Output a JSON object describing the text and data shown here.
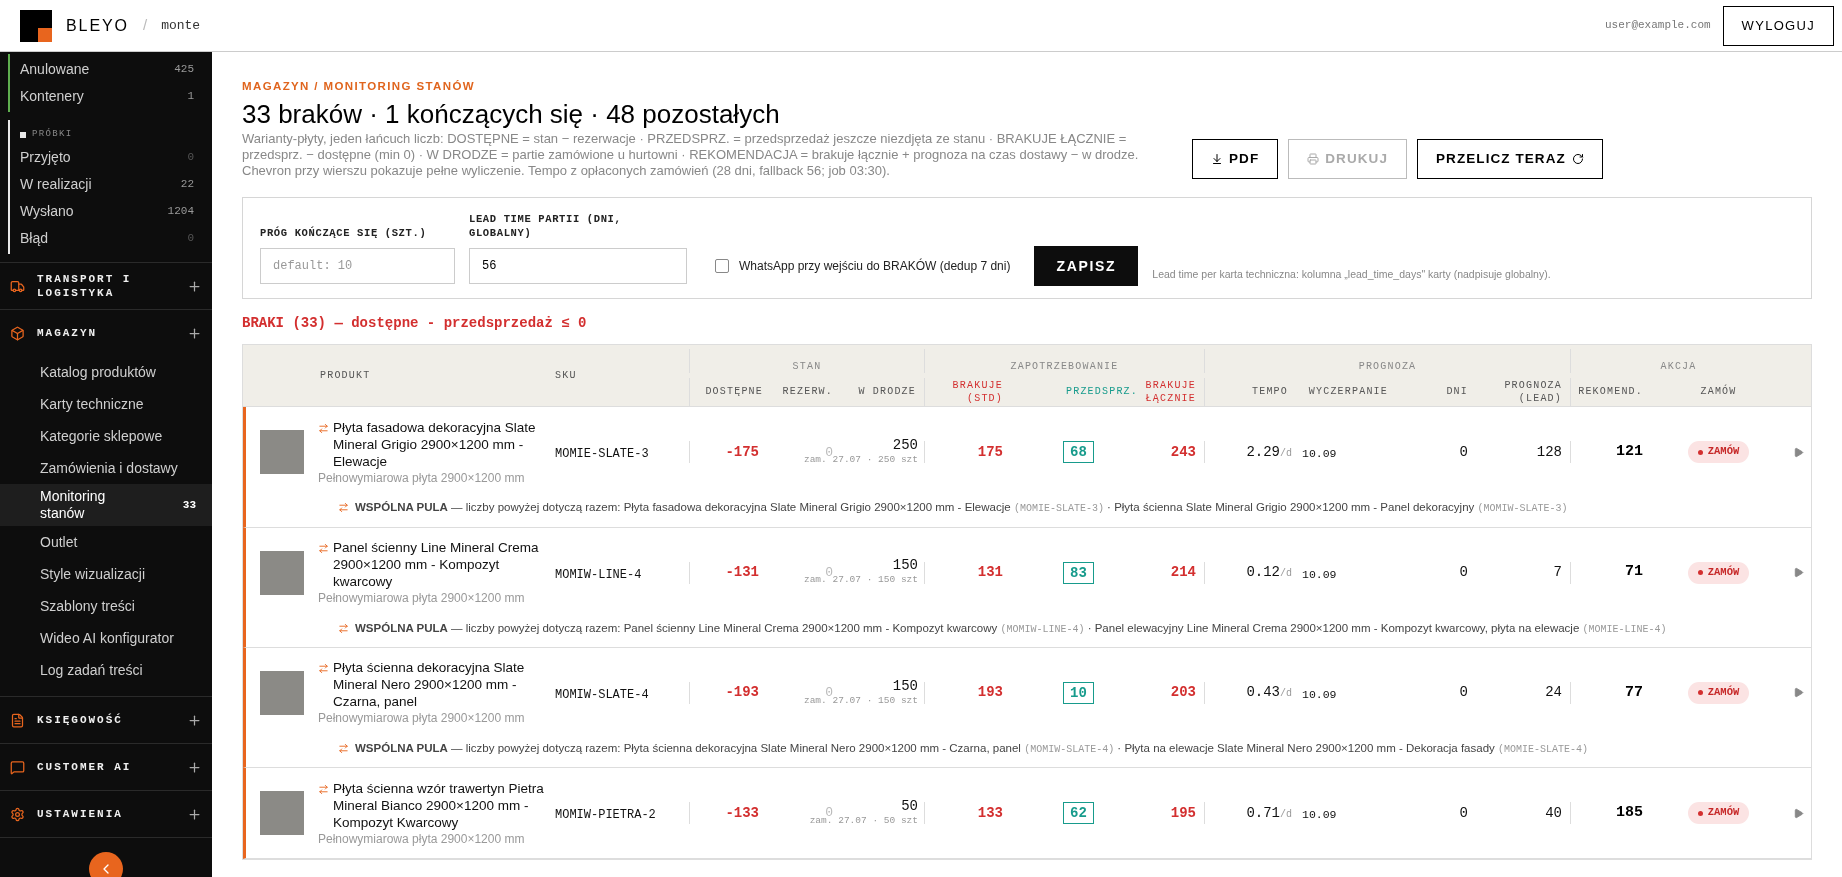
{
  "header": {
    "logo": "BLEYO",
    "separator": "/",
    "tenant": "monte",
    "user": "user@example.com",
    "logout": "WYLOGUJ"
  },
  "sidebar": {
    "status_groups": [
      {
        "color": "#5fae4f",
        "items": [
          {
            "label": "Anulowane",
            "count": "425",
            "muted": false
          },
          {
            "label": "Kontenery",
            "count": "1",
            "muted": false
          }
        ]
      },
      {
        "color": "#e8e8e8",
        "title": "PRÓBKI",
        "items": [
          {
            "label": "Przyjęto",
            "count": "0",
            "muted": true
          },
          {
            "label": "W realizacji",
            "count": "22",
            "muted": false
          },
          {
            "label": "Wysłano",
            "count": "1204",
            "muted": false
          },
          {
            "label": "Błąd",
            "count": "0",
            "muted": true
          }
        ]
      }
    ],
    "sections": [
      {
        "label": "TRANSPORT I LOGISTYKA",
        "kind": "truck"
      },
      {
        "label": "MAGAZYN",
        "kind": "box",
        "items": [
          {
            "label": "Katalog produktów",
            "selected": false
          },
          {
            "label": "Karty techniczne",
            "selected": false
          },
          {
            "label": "Kategorie sklepowe",
            "selected": false
          },
          {
            "label": "Zamówienia i dostawy",
            "selected": false
          },
          {
            "label": "Monitoring stanów",
            "selected": true,
            "count": "33"
          },
          {
            "label": "Outlet",
            "selected": false
          },
          {
            "label": "Style wizualizacji",
            "selected": false
          },
          {
            "label": "Szablony treści",
            "selected": false
          },
          {
            "label": "Wideo AI konfigurator",
            "selected": false
          },
          {
            "label": "Log zadań treści",
            "selected": false
          }
        ]
      },
      {
        "label": "KSIĘGOWOŚĆ",
        "kind": "document"
      },
      {
        "label": "CUSTOMER AI",
        "kind": "chat"
      },
      {
        "label": "USTAWIENIA",
        "kind": "gear"
      }
    ]
  },
  "page": {
    "breadcrumb": "MAGAZYN / MONITORING STANÓW",
    "title": "33 braków · 1 kończących się · 48 pozostałych",
    "description": "Warianty-płyty, jeden łańcuch liczb: DOSTĘPNE = stan − rezerwacje · PRZEDSPRZ. = przedsprzedaż jeszcze niezdjęta ze stanu · BRAKUJE ŁĄCZNIE = przedsprz. − dostępne (min 0) · W DRODZE = partie zamówione u hurtowni · REKOMENDACJA = brakuje łącznie + prognoza na czas dostawy − w drodze. Chevron przy wierszu pokazuje pełne wyliczenie. Tempo z opłaconych zamówień (28 dni, fallback 56; job 03:30).",
    "actions": [
      {
        "label": "PDF",
        "kind": "download",
        "disabled": false
      },
      {
        "label": "DRUKUJ",
        "kind": "print",
        "disabled": true
      },
      {
        "label": "PRZELICZ TERAZ",
        "kind": "recalculate",
        "disabled": false
      }
    ]
  },
  "settings": {
    "fields": [
      {
        "label": "PRÓG KOŃCZĄCE SIĘ (SZT.)",
        "placeholder": "default: 10"
      },
      {
        "label": "LEAD TIME PARTII (DNI, GLOBALNY)",
        "value": "56"
      }
    ],
    "whatsapp": {
      "label": "WhatsApp przy wejściu do BRAKÓW (dedup 7 dni)",
      "checked": false
    },
    "save": "ZAPISZ",
    "note": "Lead time per karta techniczna: kolumna „lead_time_days\" karty (nadpisuje globalny)."
  },
  "section_title": "BRAKI (33) — dostępne - przedsprzedaż ≤ 0",
  "table": {
    "leading_columns": [
      "PRODUKT",
      "SKU"
    ],
    "groups": [
      {
        "label": "STAN",
        "columns": [
          {
            "label": "DOSTĘPNE",
            "color": "#555555"
          },
          {
            "label": "REZERW.",
            "color": "#555555"
          },
          {
            "label": "W DRODZE",
            "color": "#555555"
          }
        ]
      },
      {
        "label": "ZAPOTRZEBOWANIE",
        "columns": [
          {
            "label": "BRAKUJE (STD)",
            "color": "#d32f2f"
          },
          {
            "label": "PRZEDSPRZ.",
            "color": "#179b8c"
          },
          {
            "label": "BRAKUJE ŁĄCZNIE",
            "color": "#d32f2f"
          }
        ]
      },
      {
        "label": "PROGNOZA",
        "columns": [
          {
            "label": "TEMPO",
            "color": "#555555"
          },
          {
            "label": "WYCZERPANIE",
            "color": "#555555"
          },
          {
            "label": "DNI",
            "color": "#555555"
          },
          {
            "label": "PROGNOZA (LEAD)",
            "color": "#555555"
          }
        ]
      },
      {
        "label": "AKCJA",
        "columns": [
          {
            "label": "REKOMEND.",
            "color": "#555555"
          },
          {
            "label": "ZAMÓW",
            "color": "#555555"
          }
        ]
      }
    ],
    "rows": [
      {
        "title": "Płyta fasadowa dekoracyjna Slate Mineral Grigio 2900×1200 mm - Elewacje",
        "subtitle": "Pełnowymiarowa płyta 2900×1200 mm",
        "sku": "MOMIE-SLATE-3",
        "available": "-175",
        "reserved": "0",
        "in_transit": "250",
        "transit_note": "zam. 27.07 · 250 szt",
        "shortage": "175",
        "presale": "68",
        "shortage_total": "243",
        "tempo": "2.29",
        "tempo_unit": "/d",
        "depletion": "10.09",
        "days": "0",
        "forecast": "128",
        "recommended": "121",
        "order": "ZAMÓW",
        "pool": {
          "lead": "**WSPÓLNA PULA** — liczby powyżej dotyczą razem:",
          "separator": "·",
          "variants": [
            {
              "name": "Płyta fasadowa dekoracyjna Slate Mineral Grigio 2900×1200 mm - Elewacje",
              "sku": "(MOMIE-SLATE-3)"
            },
            {
              "name": "Płyta ścienna Slate Mineral Grigio 2900×1200 mm - Panel dekoracyjny",
              "sku": "(MOMIW-SLATE-3)"
            }
          ]
        }
      },
      {
        "title": "Panel ścienny Line Mineral Crema 2900×1200 mm - Kompozyt kwarcowy",
        "subtitle": "Pełnowymiarowa płyta 2900×1200 mm",
        "sku": "MOMIW-LINE-4",
        "available": "-131",
        "reserved": "0",
        "in_transit": "150",
        "transit_note": "zam. 27.07 · 150 szt",
        "shortage": "131",
        "presale": "83",
        "shortage_total": "214",
        "tempo": "0.12",
        "tempo_unit": "/d",
        "depletion": "10.09",
        "days": "0",
        "forecast": "7",
        "recommended": "71",
        "order": "ZAMÓW",
        "pool": {
          "lead": "**WSPÓLNA PULA** — liczby powyżej dotyczą razem:",
          "separator": "·",
          "variants": [
            {
              "name": "Panel ścienny Line Mineral Crema 2900×1200 mm - Kompozyt kwarcowy",
              "sku": "(MOMIW-LINE-4)"
            },
            {
              "name": "Panel elewacyjny Line Mineral Crema 2900×1200 mm - Kompozyt kwarcowy, płyta na elewacje",
              "sku": "(MOMIE-LINE-4)"
            }
          ]
        }
      },
      {
        "title": "Płyta ścienna dekoracyjna Slate Mineral Nero 2900×1200 mm - Czarna, panel",
        "subtitle": "Pełnowymiarowa płyta 2900×1200 mm",
        "sku": "MOMIW-SLATE-4",
        "available": "-193",
        "reserved": "0",
        "in_transit": "150",
        "transit_note": "zam. 27.07 · 150 szt",
        "shortage": "193",
        "presale": "10",
        "shortage_total": "203",
        "tempo": "0.43",
        "tempo_unit": "/d",
        "depletion": "10.09",
        "days": "0",
        "forecast": "24",
        "recommended": "77",
        "order": "ZAMÓW",
        "pool": {
          "lead": "**WSPÓLNA PULA** — liczby powyżej dotyczą razem:",
          "separator": "·",
          "variants": [
            {
              "name": "Płyta ścienna dekoracyjna Slate Mineral Nero 2900×1200 mm - Czarna, panel",
              "sku": "(MOMIW-SLATE-4)"
            },
            {
              "name": "Płyta na elewacje Slate Mineral Nero 2900×1200 mm - Dekoracja fasady",
              "sku": "(MOMIE-SLATE-4)"
            }
          ]
        }
      },
      {
        "title": "Płyta ścienna wzór trawertyn Pietra Mineral Bianco 2900×1200 mm - Kompozyt Kwarcowy",
        "subtitle": "Pełnowymiarowa płyta 2900×1200 mm",
        "sku": "MOMIW-PIETRA-2",
        "available": "-133",
        "reserved": "0",
        "in_transit": "50",
        "transit_note": "zam. 27.07 · 50 szt",
        "shortage": "133",
        "presale": "62",
        "shortage_total": "195",
        "tempo": "0.71",
        "tempo_unit": "/d",
        "depletion": "10.09",
        "days": "0",
        "forecast": "40",
        "recommended": "185",
        "order": "ZAMÓW"
      }
    ]
  }
}
